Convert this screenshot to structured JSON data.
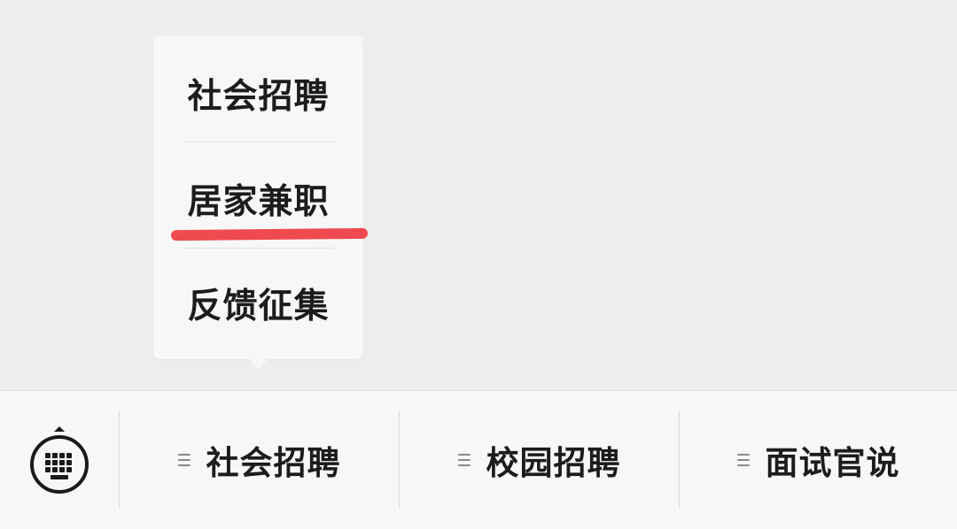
{
  "popup": {
    "items": [
      {
        "label": "社会招聘"
      },
      {
        "label": "居家兼职",
        "highlighted": true
      },
      {
        "label": "反馈征集"
      }
    ]
  },
  "bottom_bar": {
    "keyboard_icon": "keyboard-icon",
    "tabs": [
      {
        "label": "社会招聘",
        "icon": "menu-lines-icon"
      },
      {
        "label": "校园招聘",
        "icon": "menu-lines-icon"
      },
      {
        "label": "面试官说",
        "icon": "menu-lines-icon"
      }
    ]
  },
  "colors": {
    "background": "#ededed",
    "panel": "#f7f7f7",
    "text": "#1c1c1c",
    "highlight": "#ef4a4f"
  }
}
